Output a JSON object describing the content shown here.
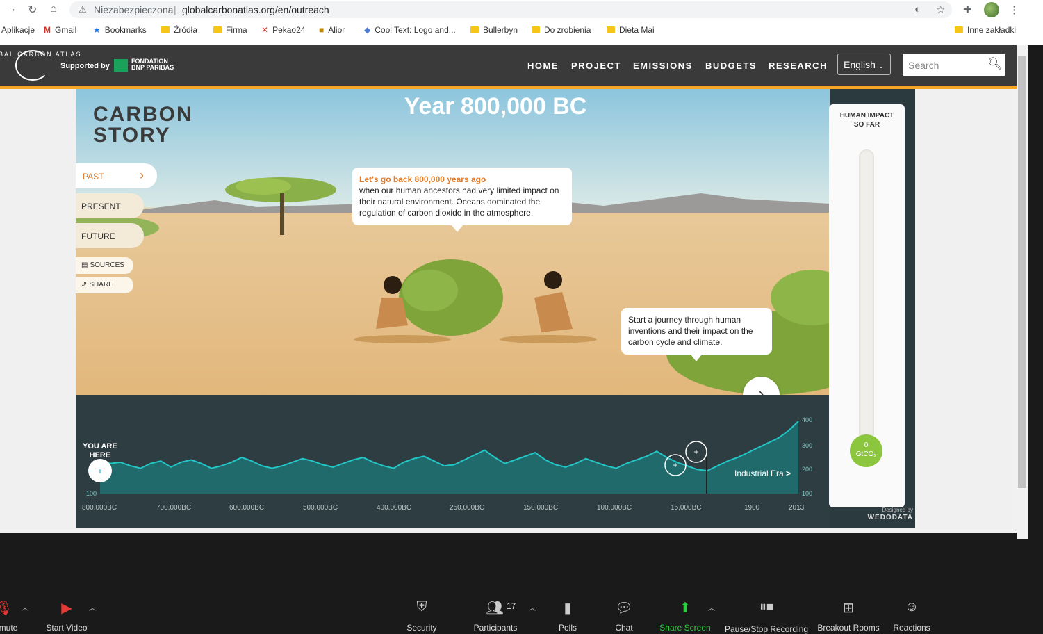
{
  "browser": {
    "insecure_label": "Niezabezpieczona",
    "url": "globalcarbonatlas.org/en/outreach",
    "bookmarks": [
      {
        "label": "Aplikacje"
      },
      {
        "label": "Gmail"
      },
      {
        "label": "Bookmarks"
      },
      {
        "label": "Źródła"
      },
      {
        "label": "Firma"
      },
      {
        "label": "Pekao24"
      },
      {
        "label": "Alior"
      },
      {
        "label": "Cool Text: Logo and..."
      },
      {
        "label": "Bullerbyn"
      },
      {
        "label": "Do zrobienia"
      },
      {
        "label": "Dieta Mai"
      },
      {
        "label": "Inne zakładki"
      }
    ]
  },
  "site": {
    "logo_text": "BAL CARBON ATLAS",
    "supported_by": "Supported by",
    "sponsor": "FONDATION BNP PARIBAS",
    "nav": [
      "HOME",
      "PROJECT",
      "EMISSIONS",
      "BUDGETS",
      "RESEARCH"
    ],
    "language": "English",
    "search_placeholder": "Search"
  },
  "story": {
    "title": "Year 800,000 BC",
    "brand_line1": "CARBON",
    "brand_line2": "STORY",
    "menu": [
      "PAST",
      "PRESENT",
      "FUTURE"
    ],
    "sources": "SOURCES",
    "share": "SHARE",
    "bubble1_highlight": "Let's go back 800,000 years ago",
    "bubble1_text": "when our human ancestors had very limited impact on their natural environment. Oceans dominated the regulation of carbon dioxide in the atmosphere.",
    "bubble2_text": "Start a journey through human inventions and their impact on the carbon cycle and climate.",
    "you_are_here_1": "YOU ARE",
    "you_are_here_2": "HERE",
    "industrial_era": "Industrial Era",
    "impact_title_1": "HUMAN IMPACT",
    "impact_title_2": "SO FAR",
    "impact_value": "0",
    "impact_unit": "GtCO₂",
    "designed_by": "Designed by",
    "designer": "WEDODATA"
  },
  "chart_data": {
    "type": "area",
    "x_tick_labels": [
      "800,000BC",
      "700,000BC",
      "600,000BC",
      "500,000BC",
      "400,000BC",
      "250,000BC",
      "150,000BC",
      "100,000BC",
      "15,000BC",
      "1900",
      "2013"
    ],
    "y_tick_labels": [
      "100",
      "200",
      "300",
      "400"
    ],
    "ylim": [
      100,
      400
    ],
    "series": [
      {
        "values": [
          240,
          225,
          230,
          215,
          205,
          225,
          235,
          210,
          230,
          240,
          225,
          205,
          215,
          230,
          250,
          235,
          215,
          205,
          215,
          230,
          245,
          235,
          220,
          210,
          225,
          240,
          250,
          230,
          215,
          205,
          230,
          245,
          255,
          235,
          215,
          220,
          240,
          260,
          280,
          250,
          225,
          240,
          255,
          270,
          240,
          220,
          210,
          225,
          245,
          230,
          215,
          205,
          225,
          240,
          255,
          275,
          250,
          230,
          215,
          200,
          195,
          215,
          235,
          250,
          270,
          290,
          310,
          330,
          360,
          400
        ]
      }
    ]
  },
  "zoom": {
    "items": [
      "mute",
      "Start Video",
      "Security",
      "Participants",
      "Polls",
      "Chat",
      "Share Screen",
      "Pause/Stop Recording",
      "Breakout Rooms",
      "Reactions"
    ],
    "participants_count": "17"
  }
}
